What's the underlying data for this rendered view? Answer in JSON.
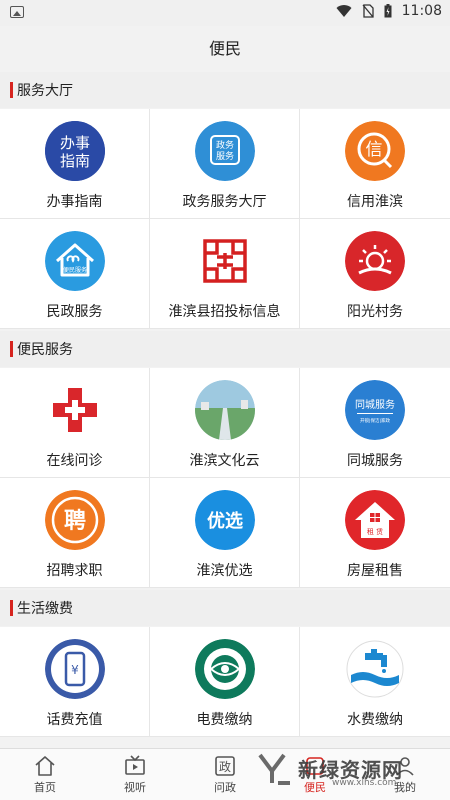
{
  "status": {
    "time": "11:08"
  },
  "page": {
    "title": "便民"
  },
  "sections": [
    {
      "title": "服务大厅",
      "items": [
        {
          "label": "办事指南",
          "icon": "guide-icon",
          "icon_text": "办事\n指南",
          "color": "#2f4fa8"
        },
        {
          "label": "政务服务大厅",
          "icon": "gov-service-icon",
          "icon_text": "政务\n服务",
          "color": "#2f8fd6"
        },
        {
          "label": "信用淮滨",
          "icon": "credit-icon",
          "icon_text": "信",
          "color": "#f07820"
        },
        {
          "label": "民政服务",
          "icon": "civil-affairs-icon",
          "icon_text": "便民服务",
          "color": "#2a9be0"
        },
        {
          "label": "淮滨县招投标信息",
          "icon": "bidding-icon",
          "icon_text": "",
          "color": "#d42020"
        },
        {
          "label": "阳光村务",
          "icon": "sunshine-village-icon",
          "icon_text": "",
          "color": "#d8262a"
        }
      ]
    },
    {
      "title": "便民服务",
      "items": [
        {
          "label": "在线问诊",
          "icon": "medical-cross-icon",
          "icon_text": "",
          "color": "#d9262b"
        },
        {
          "label": "淮滨文化云",
          "icon": "culture-cloud-icon",
          "icon_text": "",
          "color": "#6aa66a"
        },
        {
          "label": "同城服务",
          "icon": "local-service-icon",
          "icon_text": "同城服务",
          "color": "#2a7fd2"
        },
        {
          "label": "招聘求职",
          "icon": "recruit-icon",
          "icon_text": "聘",
          "color": "#f07820"
        },
        {
          "label": "淮滨优选",
          "icon": "preferred-icon",
          "icon_text": "优选",
          "color": "#1a8fe0"
        },
        {
          "label": "房屋租售",
          "icon": "house-rent-icon",
          "icon_text": "租 赁",
          "color": "#e0262a"
        }
      ]
    },
    {
      "title": "生活缴费",
      "items": [
        {
          "label": "话费充值",
          "icon": "phone-recharge-icon",
          "icon_text": "¥",
          "color": "#3a5aa8"
        },
        {
          "label": "电费缴纳",
          "icon": "electricity-icon",
          "icon_text": "",
          "color": "#0e7a5c"
        },
        {
          "label": "水费缴纳",
          "icon": "water-icon",
          "icon_text": "",
          "color": "#1c88d0"
        }
      ]
    }
  ],
  "nav": [
    {
      "label": "首页",
      "icon": "home-icon"
    },
    {
      "label": "视听",
      "icon": "tv-icon"
    },
    {
      "label": "问政",
      "icon": "politics-icon",
      "icon_text": "政"
    },
    {
      "label": "便民",
      "icon": "service-icon",
      "active": true
    },
    {
      "label": "我的",
      "icon": "profile-icon"
    }
  ],
  "watermark": {
    "text": "新绿资源网",
    "sub": "www.xlhs.com"
  }
}
